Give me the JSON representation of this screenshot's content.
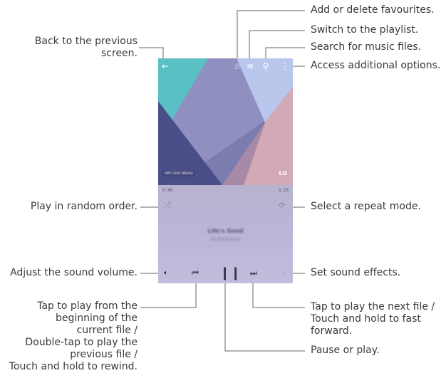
{
  "callouts": {
    "back": "Back to the previous\nscreen.",
    "favourites": "Add or delete favourites.",
    "playlist": "Switch to the playlist.",
    "search": "Search for music files.",
    "options": "Access additional options.",
    "random": "Play in random order.",
    "repeat": "Select a repeat mode.",
    "volume": "Adjust the sound volume.",
    "effects": "Set sound effects.",
    "previous": "Tap to play from the\nbeginning of the\ncurrent file /\nDouble-tap to play the\nprevious file /\nTouch and hold to rewind.",
    "next": "Tap to play the next file /\nTouch and hold to fast\nforward.",
    "pause": "Pause or play."
  },
  "screen": {
    "elapsed": "0:00",
    "duration": "3:23",
    "track_title": "Life's Good",
    "artist": "LG Electronics",
    "badge": "HIFI  UHQ 96kHz",
    "brand": "LG"
  },
  "icons": {
    "back": "back-arrow-icon",
    "favourite": "star-icon",
    "playlist": "playlist-icon",
    "search": "search-icon",
    "more": "more-vertical-icon",
    "shuffle": "shuffle-icon",
    "repeat": "repeat-icon",
    "volume": "volume-icon",
    "rewind": "rewind-icon",
    "pause": "pause-icon",
    "fast_forward": "fast-forward-icon",
    "effects": "equalizer-icon"
  },
  "colors": {
    "line": "#666666",
    "player_bg": "#bcb6d8",
    "artwork_teal": "#5bc0c5",
    "artwork_purple": "#7d7cae"
  }
}
